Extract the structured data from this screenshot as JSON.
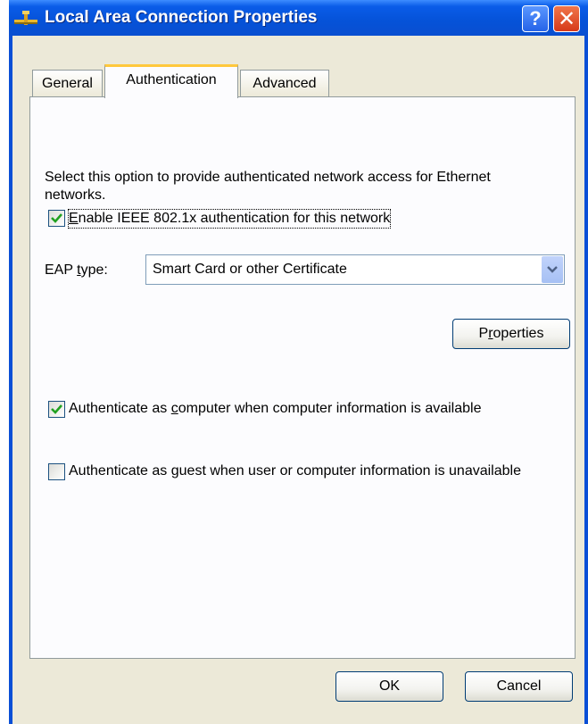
{
  "window": {
    "title": "Local Area Connection Properties",
    "help_glyph": "?",
    "close_glyph": "✕"
  },
  "tabs": [
    {
      "label": "General",
      "active": false
    },
    {
      "label": "Authentication",
      "active": true
    },
    {
      "label": "Advanced",
      "active": false
    }
  ],
  "auth": {
    "description": "Select this option to provide authenticated network access for Ethernet networks.",
    "enable_8021x": {
      "checked": true,
      "label_first": "E",
      "label_rest": "nable IEEE 802.1x authentication for this network"
    },
    "eap": {
      "label_pre": "EAP ",
      "label_u": "t",
      "label_post": "ype:",
      "selected": "Smart Card or other Certificate"
    },
    "properties_button": {
      "pre": "P",
      "u": "r",
      "post": "operties"
    },
    "auth_computer": {
      "checked": true,
      "pre": "Authenticate as ",
      "u": "c",
      "post": "omputer when computer information is available"
    },
    "auth_guest": {
      "checked": false,
      "pre": "Authenticate as ",
      "u": "g",
      "post": "uest when user or computer information is unavailable"
    }
  },
  "footer": {
    "ok_label": "OK",
    "cancel_label": "Cancel"
  },
  "colors": {
    "titlebar": "#0552d8",
    "checkmark": "#21a121",
    "active_tab_accent": "#ffc83c"
  }
}
